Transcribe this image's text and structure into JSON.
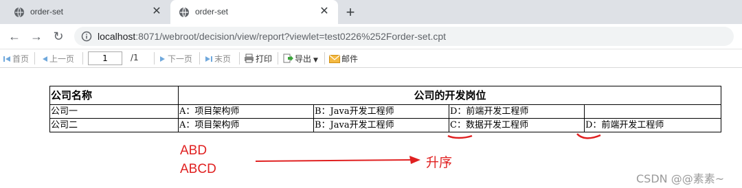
{
  "browser": {
    "tabs": [
      {
        "title": "order-set",
        "active": false
      },
      {
        "title": "order-set",
        "active": true
      }
    ],
    "url_host": "localhost",
    "url_rest": ":8071/webroot/decision/view/report?viewlet=test0226%252Forder-set.cpt"
  },
  "toolbar": {
    "first": "首页",
    "prev": "上一页",
    "page_value": "1",
    "page_total": "/1",
    "next": "下一页",
    "last": "末页",
    "print": "打印",
    "export": "导出",
    "mail": "邮件"
  },
  "report": {
    "header": {
      "company_col": "公司名称",
      "positions_col": "公司的开发岗位"
    },
    "rows": [
      {
        "company": "公司一",
        "p1": "A：项目架构师",
        "p2": "B：Java开发工程师",
        "p3": "D：前端开发工程师",
        "p4": ""
      },
      {
        "company": "公司二",
        "p1": "A：项目架构师",
        "p2": "B：Java开发工程师",
        "p3": "C：数据开发工程师",
        "p4": "D：前端开发工程师"
      }
    ]
  },
  "annotations": {
    "line1": "ABD",
    "line2": "ABCD",
    "arrow_label": "升序",
    "color": "#e02020"
  },
  "watermark": "CSDN @@素素~"
}
